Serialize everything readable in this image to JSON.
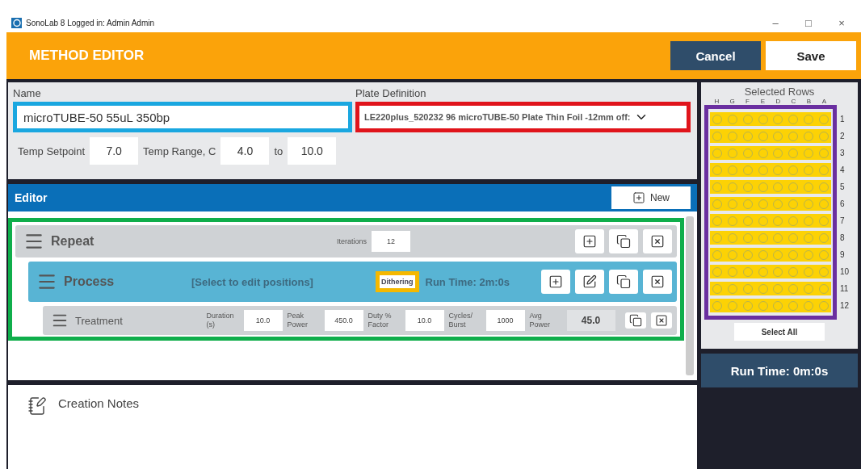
{
  "window": {
    "title": "SonoLab 8 Logged in: Admin Admin",
    "controls": [
      "–",
      "□",
      "×"
    ]
  },
  "header": {
    "title": "METHOD EDITOR",
    "buttons": [
      {
        "label": "Cancel",
        "kind": "secondary"
      },
      {
        "label": "Save",
        "kind": "primary"
      }
    ]
  },
  "method": {
    "name_label": "Name",
    "name": "microTUBE-50 55uL 350bp",
    "name_frame": {
      "color": "#1aa7e0"
    },
    "plate_label": "Plate Definition",
    "plate": "LE220plus_520232 96 microTUBE-50 Plate Thin Foil -12mm off:",
    "plate_frame": {
      "color": "#e0141b"
    },
    "temp_setpoint_label": "Temp Setpoint",
    "temp_setpoint": "7.0",
    "temp_range_label": "Temp Range, C",
    "temp_min": "4.0",
    "to_label": "to",
    "temp_max": "10.0"
  },
  "editor": {
    "title": "Editor",
    "new_button": "New",
    "frame": {
      "color": "#0fae4b"
    },
    "steps": [
      {
        "kind": "repeat",
        "title": "Repeat",
        "fields": [
          {
            "label": "Iterations",
            "value": "12"
          }
        ],
        "actions": [
          {
            "kind": "add"
          },
          {
            "kind": "copy"
          },
          {
            "kind": "delete"
          }
        ],
        "children": [
          {
            "kind": "process",
            "title": "Process",
            "note": "[Select to edit positions]",
            "badge": "Dithering",
            "badge_frame": {
              "color": "#f5b800"
            },
            "run_time": "Run Time: 2m:0s",
            "actions": [
              {
                "kind": "add"
              },
              {
                "kind": "edit"
              },
              {
                "kind": "copy"
              },
              {
                "kind": "delete"
              }
            ],
            "children": [
              {
                "kind": "treatment",
                "title": "Treatment",
                "fields": [
                  {
                    "label": "Duration (s)",
                    "value": "10.0"
                  },
                  {
                    "label": "Peak Power",
                    "value": "450.0"
                  },
                  {
                    "label": "Duty % Factor",
                    "value": "10.0"
                  },
                  {
                    "label": "Cycles/ Burst",
                    "value": "1000"
                  },
                  {
                    "label": "Avg Power",
                    "value": "45.0",
                    "readonly": true
                  }
                ],
                "actions": [
                  {
                    "kind": "copy"
                  },
                  {
                    "kind": "delete"
                  }
                ]
              }
            ]
          }
        ]
      }
    ]
  },
  "plate": {
    "title": "Selected Rows",
    "frame": {
      "color": "#6a2fa0"
    },
    "columns": [
      "H",
      "G",
      "F",
      "E",
      "D",
      "C",
      "B",
      "A"
    ],
    "rows": [
      {
        "label": "1",
        "selected": true
      },
      {
        "label": "2",
        "selected": true
      },
      {
        "label": "3",
        "selected": true
      },
      {
        "label": "4",
        "selected": true
      },
      {
        "label": "5",
        "selected": true
      },
      {
        "label": "6",
        "selected": true
      },
      {
        "label": "7",
        "selected": true
      },
      {
        "label": "8",
        "selected": true
      },
      {
        "label": "9",
        "selected": true
      },
      {
        "label": "10",
        "selected": true
      },
      {
        "label": "11",
        "selected": true
      },
      {
        "label": "12",
        "selected": true
      }
    ],
    "select_all": "Select All"
  },
  "run_time": "Run Time: 0m:0s",
  "notes": {
    "title": "Creation Notes"
  }
}
